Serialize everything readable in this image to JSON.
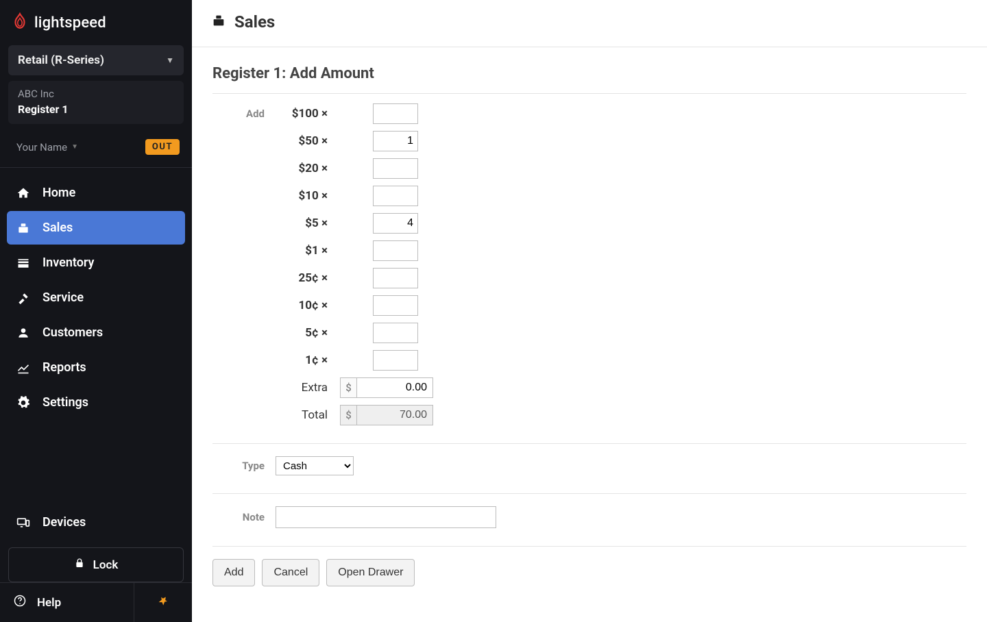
{
  "brand": {
    "name": "lightspeed"
  },
  "sidebar": {
    "series": "Retail (R-Series)",
    "company": "ABC Inc",
    "register": "Register 1",
    "user": "Your Name",
    "out_badge": "OUT",
    "nav": [
      {
        "id": "home",
        "label": "Home",
        "active": false
      },
      {
        "id": "sales",
        "label": "Sales",
        "active": true
      },
      {
        "id": "inventory",
        "label": "Inventory",
        "active": false
      },
      {
        "id": "service",
        "label": "Service",
        "active": false
      },
      {
        "id": "customers",
        "label": "Customers",
        "active": false
      },
      {
        "id": "reports",
        "label": "Reports",
        "active": false
      },
      {
        "id": "settings",
        "label": "Settings",
        "active": false
      }
    ],
    "devices": "Devices",
    "lock": "Lock",
    "help": "Help"
  },
  "header": {
    "title": "Sales"
  },
  "page": {
    "title": "Register 1: Add Amount",
    "add_label": "Add",
    "denominations": [
      {
        "label": "$100 ×",
        "value": ""
      },
      {
        "label": "$50 ×",
        "value": "1"
      },
      {
        "label": "$20 ×",
        "value": ""
      },
      {
        "label": "$10 ×",
        "value": ""
      },
      {
        "label": "$5 ×",
        "value": "4"
      },
      {
        "label": "$1 ×",
        "value": ""
      },
      {
        "label": "25¢ ×",
        "value": ""
      },
      {
        "label": "10¢ ×",
        "value": ""
      },
      {
        "label": "5¢ ×",
        "value": ""
      },
      {
        "label": "1¢ ×",
        "value": ""
      }
    ],
    "extra_label": "Extra",
    "extra_value": "0.00",
    "total_label": "Total",
    "total_value": "70.00",
    "currency_symbol": "$",
    "type_label": "Type",
    "type_value": "Cash",
    "note_label": "Note",
    "note_value": "",
    "buttons": {
      "add": "Add",
      "cancel": "Cancel",
      "open_drawer": "Open Drawer"
    }
  }
}
